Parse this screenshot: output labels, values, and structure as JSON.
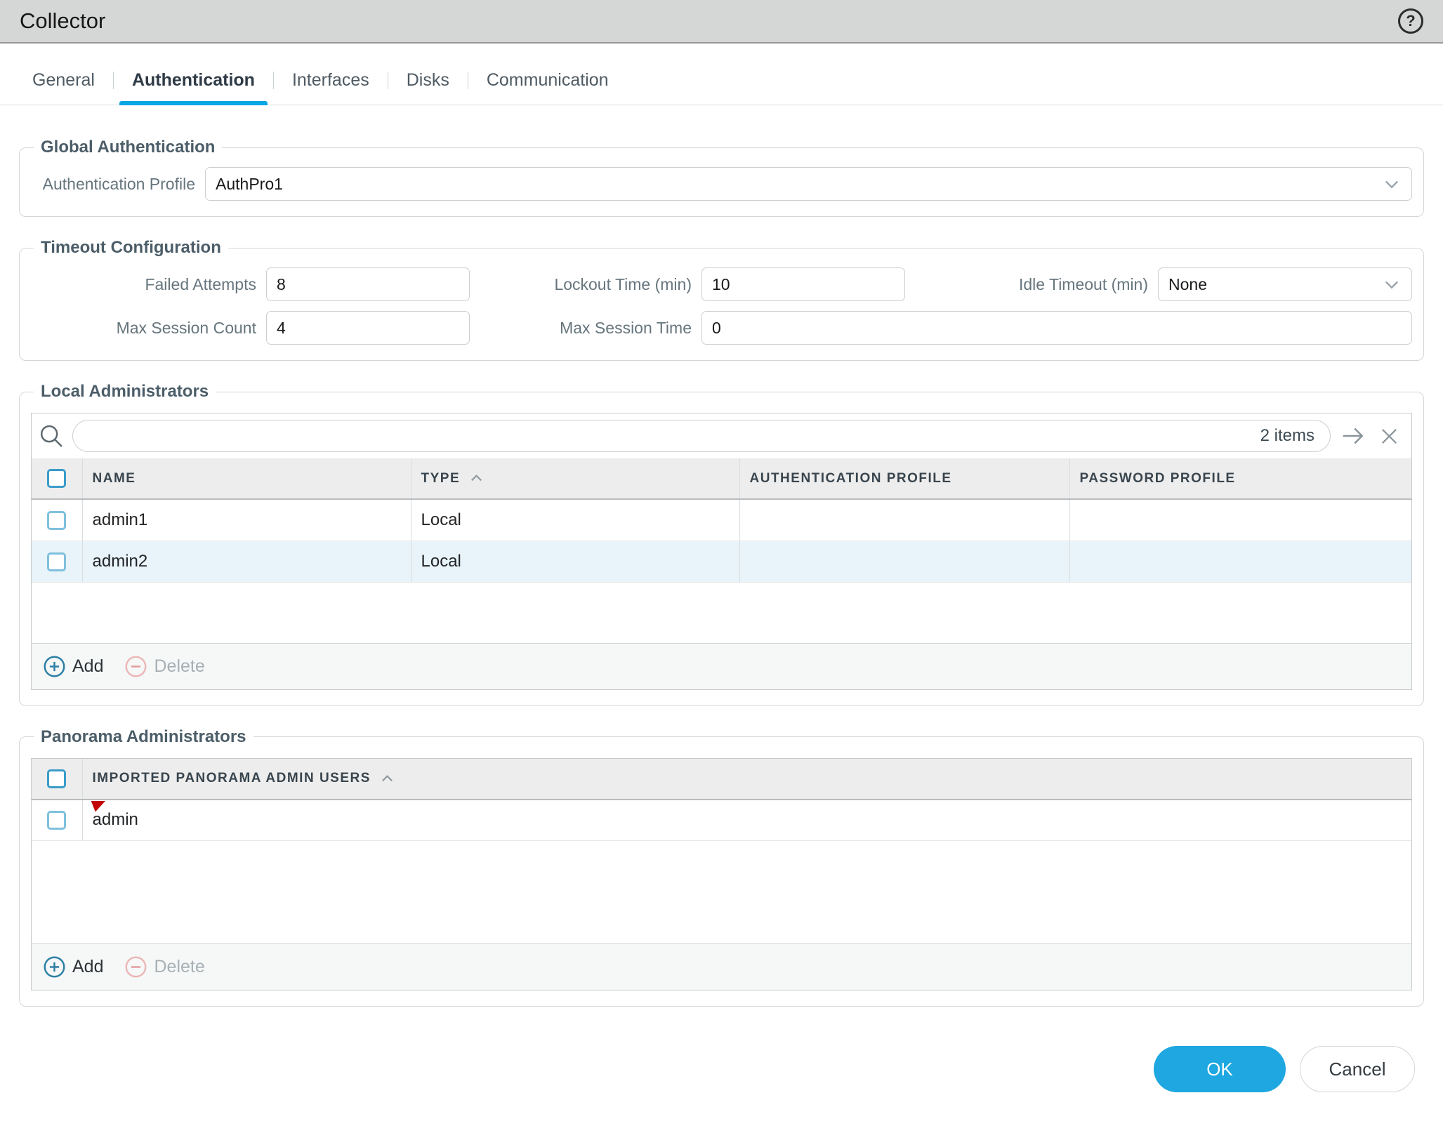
{
  "window": {
    "title": "Collector",
    "help_glyph": "?"
  },
  "tabs": [
    {
      "label": "General",
      "active": false
    },
    {
      "label": "Authentication",
      "active": true
    },
    {
      "label": "Interfaces",
      "active": false
    },
    {
      "label": "Disks",
      "active": false
    },
    {
      "label": "Communication",
      "active": false
    }
  ],
  "global_authentication": {
    "legend": "Global Authentication",
    "authentication_profile": {
      "label": "Authentication Profile",
      "value": "AuthPro1"
    }
  },
  "timeout_configuration": {
    "legend": "Timeout Configuration",
    "failed_attempts": {
      "label": "Failed Attempts",
      "value": "8"
    },
    "lockout_time": {
      "label": "Lockout Time (min)",
      "value": "10"
    },
    "idle_timeout": {
      "label": "Idle Timeout (min)",
      "value": "None"
    },
    "max_session_count": {
      "label": "Max Session Count",
      "value": "4"
    },
    "max_session_time": {
      "label": "Max Session Time",
      "value": "0"
    }
  },
  "local_administrators": {
    "legend": "Local Administrators",
    "search": {
      "placeholder": "",
      "items_count": "2 items"
    },
    "columns": {
      "name": "NAME",
      "type": "TYPE",
      "authentication_profile": "AUTHENTICATION PROFILE",
      "password_profile": "PASSWORD PROFILE"
    },
    "sort": {
      "column": "TYPE",
      "direction": "ascending"
    },
    "rows": [
      {
        "name": "admin1",
        "type": "Local",
        "authentication_profile": "",
        "password_profile": ""
      },
      {
        "name": "admin2",
        "type": "Local",
        "authentication_profile": "",
        "password_profile": ""
      }
    ],
    "actions": {
      "add": "Add",
      "delete": "Delete"
    }
  },
  "panorama_administrators": {
    "legend": "Panorama Administrators",
    "columns": {
      "imported_users": "IMPORTED PANORAMA ADMIN USERS"
    },
    "sort": {
      "column": "IMPORTED PANORAMA ADMIN USERS",
      "direction": "ascending"
    },
    "rows": [
      {
        "name": "admin",
        "modified": true
      }
    ],
    "actions": {
      "add": "Add",
      "delete": "Delete"
    }
  },
  "footer": {
    "ok": "OK",
    "cancel": "Cancel"
  },
  "colors": {
    "accent_blue": "#0ba6e4",
    "ok_button_bg": "#1ea7e0",
    "title_bar_bg": "#d5d6d6",
    "table_header_bg": "#ededed",
    "selected_row_bg": "#e9f4fa",
    "modified_marker_red": "#c40303",
    "add_icon_blue": "#2d7fa5",
    "delete_icon_pink": "#e9adad"
  }
}
